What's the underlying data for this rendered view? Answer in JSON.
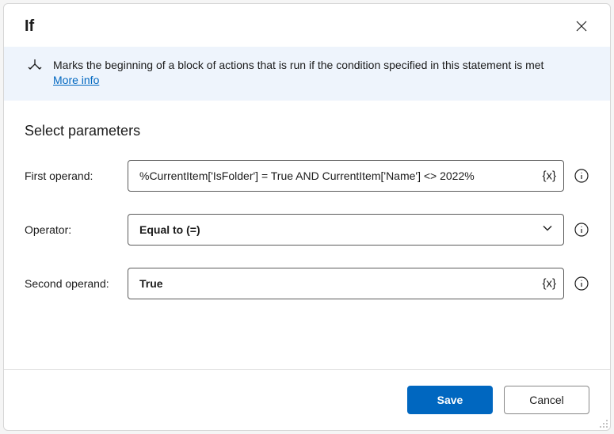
{
  "dialog": {
    "title": "If",
    "description": "Marks the beginning of a block of actions that is run if the condition specified in this statement is met",
    "more_info_label": "More info"
  },
  "section": {
    "title": "Select parameters"
  },
  "fields": {
    "first_operand": {
      "label": "First operand:",
      "value": "%CurrentItem['IsFolder'] = True AND CurrentItem['Name'] <> 2022%",
      "var_badge": "{x}"
    },
    "operator": {
      "label": "Operator:",
      "value": "Equal to (=)"
    },
    "second_operand": {
      "label": "Second operand:",
      "value": "True",
      "var_badge": "{x}"
    }
  },
  "footer": {
    "save_label": "Save",
    "cancel_label": "Cancel"
  }
}
